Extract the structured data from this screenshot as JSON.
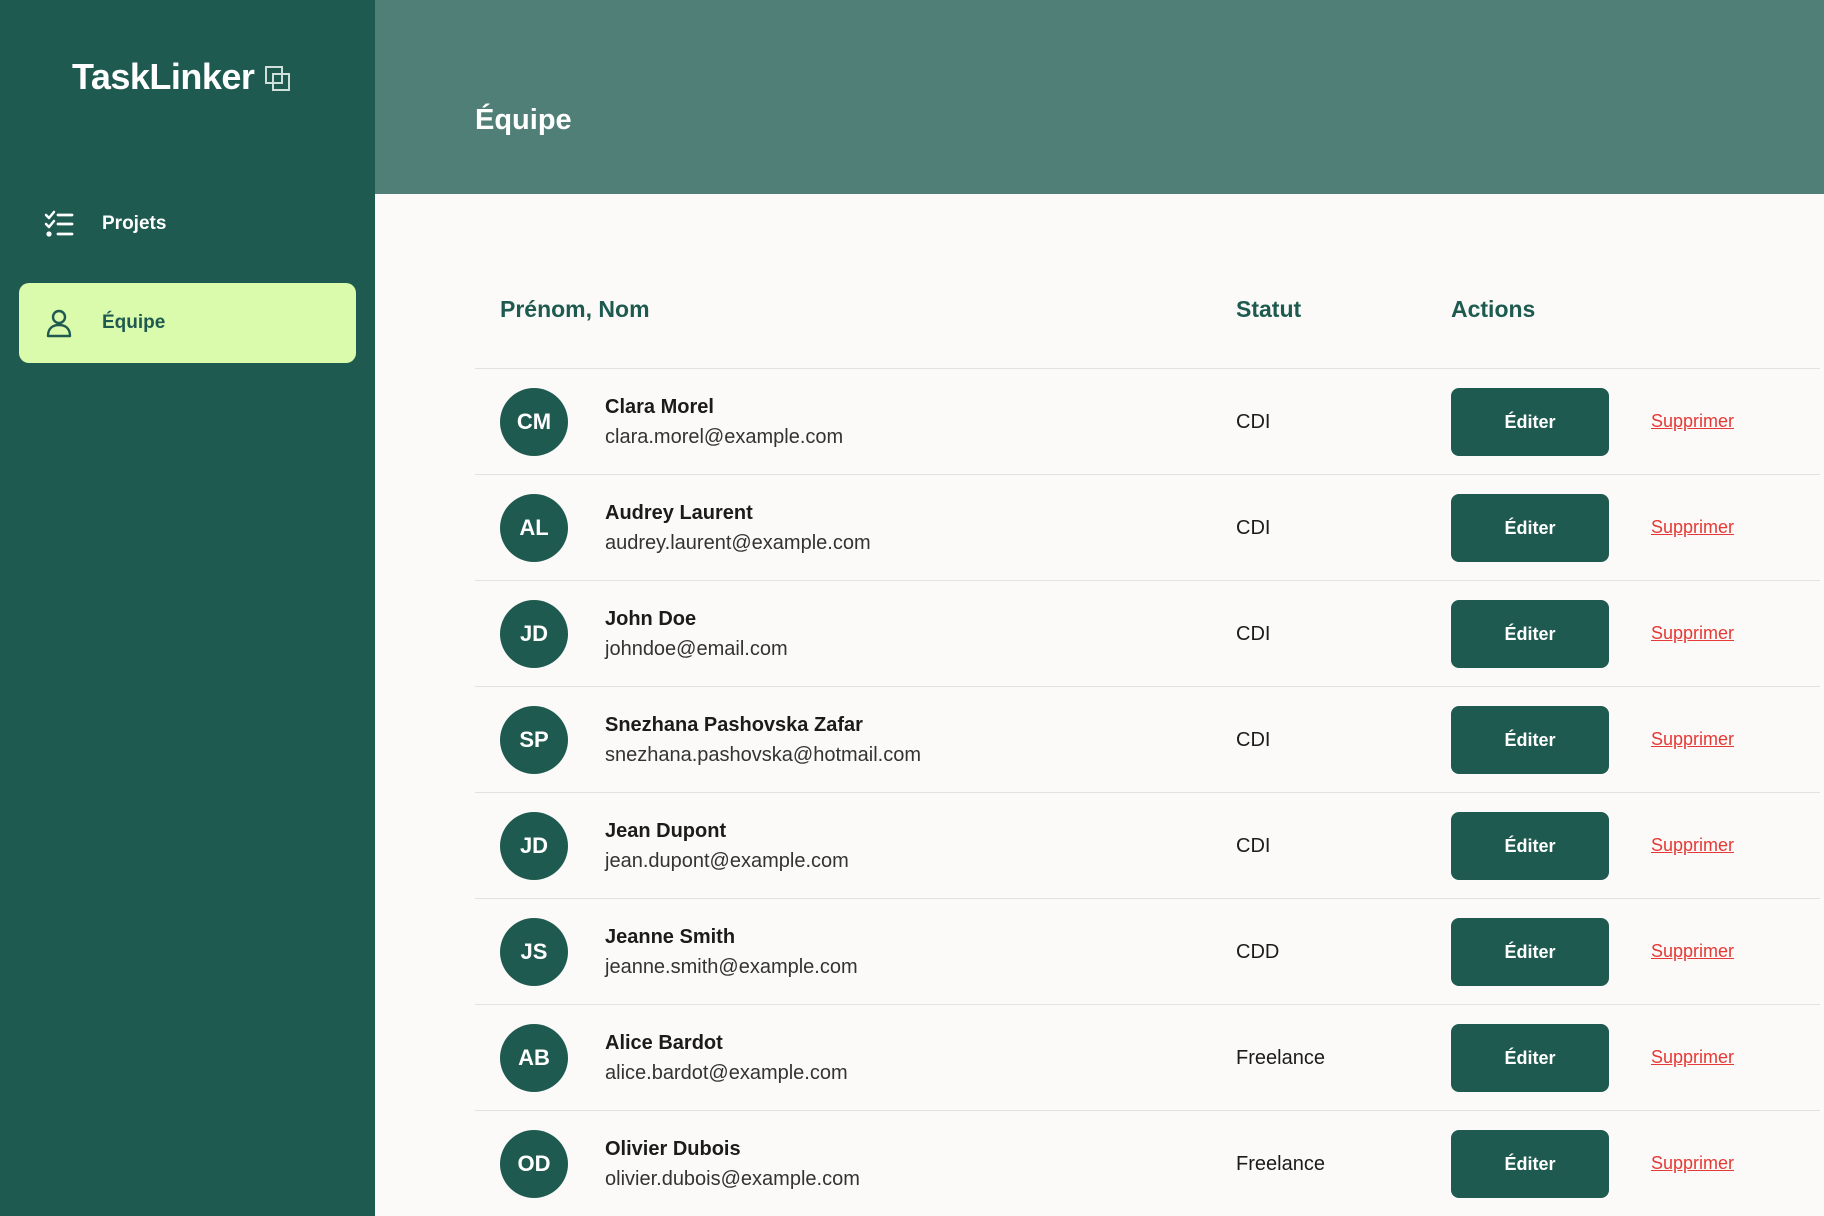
{
  "app": {
    "name": "TaskLinker"
  },
  "sidebar": {
    "items": [
      {
        "label": "Projets",
        "icon": "checklist-icon",
        "active": false
      },
      {
        "label": "Équipe",
        "icon": "user-icon",
        "active": true
      }
    ]
  },
  "header": {
    "title": "Équipe"
  },
  "table": {
    "columns": [
      "Prénom, Nom",
      "Statut",
      "Actions"
    ],
    "edit_label": "Éditer",
    "delete_label": "Supprimer",
    "rows": [
      {
        "initials": "CM",
        "name": "Clara Morel",
        "email": "clara.morel@example.com",
        "status": "CDI"
      },
      {
        "initials": "AL",
        "name": "Audrey Laurent",
        "email": "audrey.laurent@example.com",
        "status": "CDI"
      },
      {
        "initials": "JD",
        "name": "John Doe",
        "email": "johndoe@email.com",
        "status": "CDI"
      },
      {
        "initials": "SP",
        "name": "Snezhana Pashovska Zafar",
        "email": "snezhana.pashovska@hotmail.com",
        "status": "CDI"
      },
      {
        "initials": "JD",
        "name": "Jean Dupont",
        "email": "jean.dupont@example.com",
        "status": "CDI"
      },
      {
        "initials": "JS",
        "name": "Jeanne Smith",
        "email": "jeanne.smith@example.com",
        "status": "CDD"
      },
      {
        "initials": "AB",
        "name": "Alice Bardot",
        "email": "alice.bardot@example.com",
        "status": "Freelance"
      },
      {
        "initials": "OD",
        "name": "Olivier Dubois",
        "email": "olivier.dubois@example.com",
        "status": "Freelance"
      }
    ]
  },
  "colors": {
    "sidebar_bg": "#1E5A4F",
    "header_bg": "#4F7F76",
    "active_nav_bg": "#DBFBAC",
    "primary": "#1E5A4F",
    "danger": "#E53935",
    "content_bg": "#FBFAF8"
  }
}
